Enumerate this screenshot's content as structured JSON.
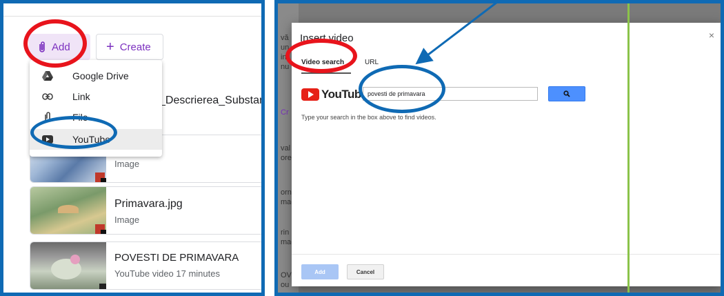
{
  "left": {
    "add_label": "Add",
    "create_label": "Create",
    "create_plus": "+",
    "menu": [
      {
        "label": "Google Drive",
        "icon": "google-drive-icon"
      },
      {
        "label": "Link",
        "icon": "link-icon"
      },
      {
        "label": "File",
        "icon": "paperclip-icon"
      },
      {
        "label": "YouTube",
        "icon": "youtube-icon"
      }
    ],
    "behind_menu_title": "_Descrierea_Substan",
    "cards": [
      {
        "title": "",
        "subtitle": "Image"
      },
      {
        "title": "Primavara.jpg",
        "subtitle": "Image"
      },
      {
        "title": "POVESTI DE PRIMAVARA",
        "subtitle": "YouTube video   17 minutes"
      }
    ]
  },
  "right": {
    "background_fragments": [
      "vă",
      "un",
      "in",
      "nu",
      "Cr",
      "val",
      "ore",
      "orn",
      "mag",
      "rin",
      "mag",
      "OV",
      "ou"
    ],
    "dialog": {
      "title": "Insert video",
      "close": "×",
      "tabs": [
        {
          "label": "Video search",
          "active": true
        },
        {
          "label": "URL",
          "active": false
        }
      ],
      "youtube_word": "YouTube",
      "search_value": "povesti de primavara",
      "helper_text": "Type your search in the box above to find videos.",
      "add_button": "Add",
      "cancel_button": "Cancel"
    }
  },
  "colors": {
    "frame_blue": "#0f6ab4",
    "annotation_red": "#e8141c",
    "annotation_green": "#8bc34a",
    "accent_purple": "#7b2fbf",
    "search_blue": "#4d90fe"
  }
}
